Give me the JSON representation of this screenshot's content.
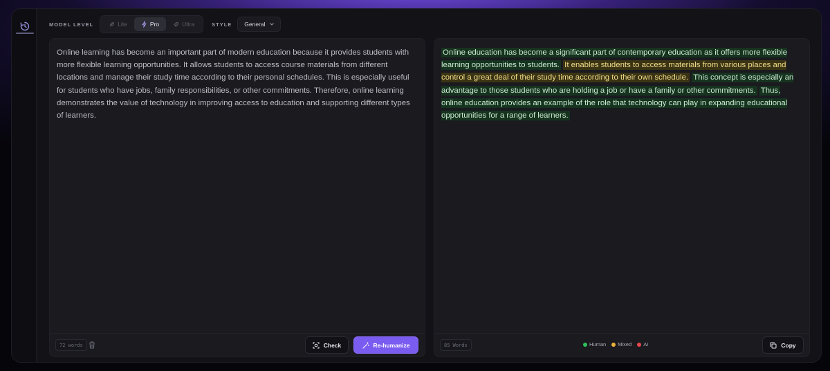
{
  "toolbar": {
    "model_level_label": "MODEL LEVEL",
    "levels": [
      {
        "label": "Lite",
        "icon": "feather-icon",
        "active": false
      },
      {
        "label": "Pro",
        "icon": "bolt-icon",
        "active": true
      },
      {
        "label": "Ultra",
        "icon": "rocket-icon",
        "active": false
      }
    ],
    "style_label": "STYLE",
    "style_value": "General"
  },
  "input_panel": {
    "text": "Online learning has become an important part of modern education because it provides students with more flexible learning opportunities. It allows students to access course materials from different locations and manage their study time according to their personal schedules. This is especially useful for students who have jobs, family responsibilities, or other commitments. Therefore, online learning demonstrates the value of technology in improving access to education and supporting different types of learners.",
    "word_count": "72 words",
    "check_label": "Check",
    "rehumanize_label": "Re-humanize"
  },
  "output_panel": {
    "segments": [
      {
        "text": "Online education has become a significant part of contemporary education as it offers more flexible learning opportunities to students.",
        "type": "human"
      },
      {
        "text": "It enables students to access materials from various places and control a great deal of their study time according to their own schedule.",
        "type": "mixed"
      },
      {
        "text": "This concept is especially an advantage to those students who are holding a job or have a family or other commitments.",
        "type": "human"
      },
      {
        "text": "Thus, online education provides an example of the role that technology can play in expanding educational opportunities for a range of learners.",
        "type": "human"
      }
    ],
    "word_count": "85 Words",
    "legend": [
      {
        "label": "Human",
        "color": "#2fbf5a"
      },
      {
        "label": "Mixed",
        "color": "#e9b23a"
      },
      {
        "label": "AI",
        "color": "#e5484d"
      }
    ],
    "copy_label": "Copy"
  },
  "colors": {
    "accent": "#7b5cf0",
    "human_highlight": "#16331f",
    "mixed_highlight": "#3b3414"
  }
}
